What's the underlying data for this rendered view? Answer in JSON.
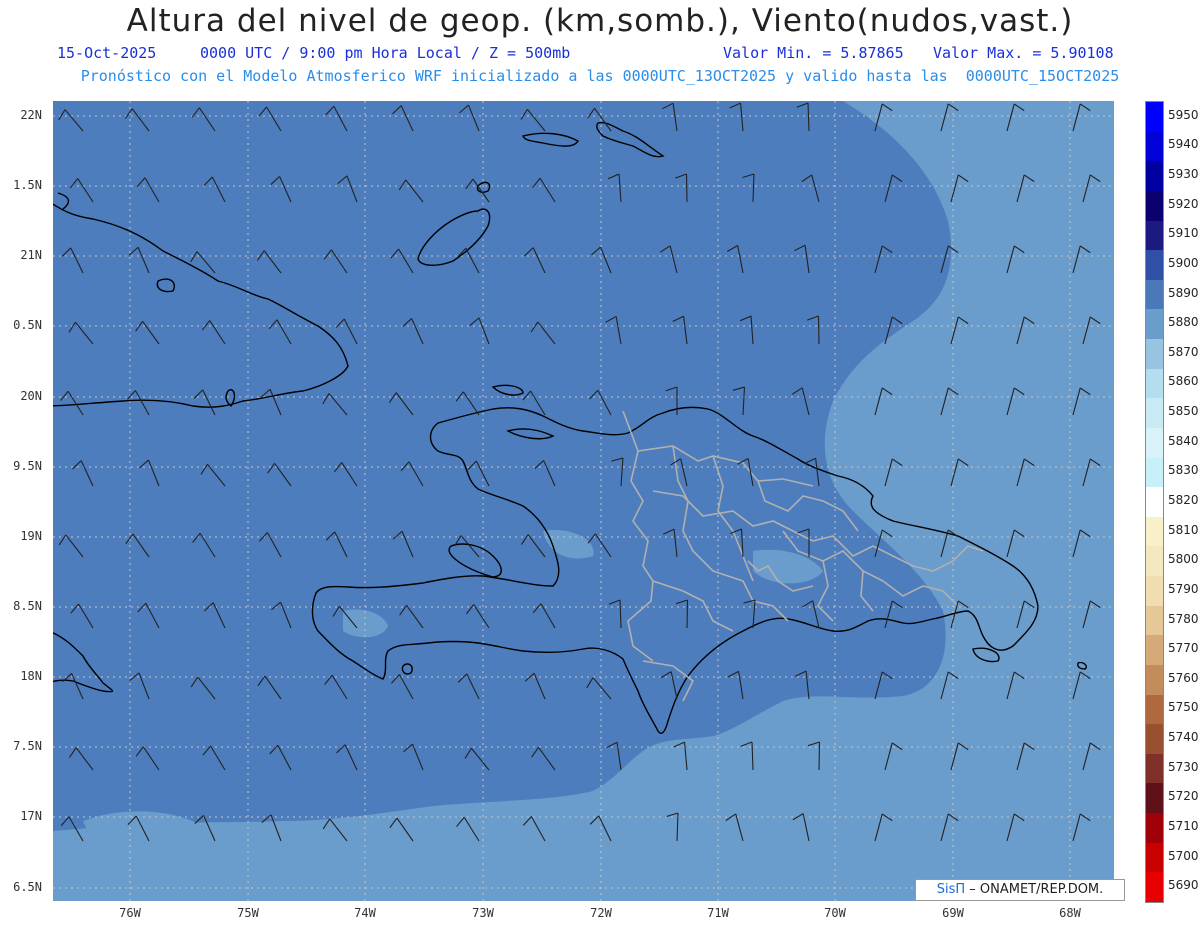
{
  "title": "Altura del nivel de geop. (km,somb.), Viento(nudos,vast.)",
  "subtitle": {
    "date": "15-Oct-2025",
    "time": "0000 UTC / 9:00 pm Hora Local / Z = 500mb",
    "min_label": "Valor Min. = 5.87865",
    "max_label": "Valor Max. = 5.90108"
  },
  "model_line": "Pronóstico con el Modelo Atmosferico WRF inicializado a las 0000UTC_13OCT2025 y valido hasta las  0000UTC_15OCT2025",
  "credit": {
    "brand": "SisΠ",
    "text": "– ONAMET/REP.DOM."
  },
  "axes": {
    "lat_labels": [
      "22N",
      "1.5N",
      "21N",
      "0.5N",
      "20N",
      "9.5N",
      "19N",
      "8.5N",
      "18N",
      "7.5N",
      "17N",
      "6.5N"
    ],
    "lon_labels": [
      "76W",
      "75W",
      "74W",
      "73W",
      "72W",
      "71W",
      "70W",
      "69W",
      "68W"
    ]
  },
  "colorbar": {
    "labels": [
      "5950",
      "5940",
      "5930",
      "5920",
      "5910",
      "5900",
      "5890",
      "5880",
      "5870",
      "5860",
      "5850",
      "5840",
      "5830",
      "5820",
      "5810",
      "5800",
      "5790",
      "5780",
      "5770",
      "5760",
      "5750",
      "5740",
      "5730",
      "5720",
      "5710",
      "5700",
      "5690"
    ],
    "colors": [
      "#0000ff",
      "#0000d8",
      "#0000a0",
      "#0a0070",
      "#1a1a80",
      "#3050a8",
      "#4a78b8",
      "#6a9ccc",
      "#98c4e2",
      "#b4def0",
      "#c8eaf4",
      "#d8f2f8",
      "#c8f0f8",
      "#ffffff",
      "#f8f0c8",
      "#f4e8c0",
      "#f0deb0",
      "#e6c898",
      "#d6aa78",
      "#c48c5a",
      "#b0683e",
      "#985030",
      "#803028",
      "#601018",
      "#a00008",
      "#c80000",
      "#e80000"
    ]
  },
  "colors": {
    "field_low": "#6a9ccc",
    "field_high": "#4d7dbd",
    "coast": "#000000",
    "provinces": "#b0b0b0",
    "grid": "#c8c8c8"
  }
}
